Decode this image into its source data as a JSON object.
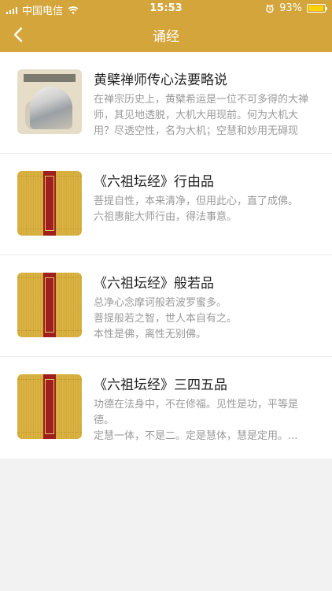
{
  "status": {
    "carrier": "中国电信",
    "time": "15:53",
    "battery_percent_text": "93%",
    "battery_level": 0.93,
    "signal_icon": "signal-icon",
    "wifi_icon": "wifi-icon",
    "alarm_icon": "alarm-icon"
  },
  "nav": {
    "title": "诵经",
    "back_icon": "back-chevron-icon"
  },
  "items": [
    {
      "title": "黄檗禅师传心法要略说",
      "desc": "在禅宗历史上，黄檗希运是一位不可多得的大禅师，其见地透脱，大机大用现前。何为大机大用？尽透空性，名为大机；空慧和妙用无碍现前..."
    },
    {
      "title": "《六祖坛经》行由品",
      "desc": "菩提自性，本来清净，但用此心，直了成佛。\n六祖惠能大师行由，得法事意。"
    },
    {
      "title": "《六祖坛经》般若品",
      "desc": "总净心念摩诃般若波罗蜜多。\n菩提般若之智，世人本自有之。\n本性是佛，离性无别佛。"
    },
    {
      "title": "《六祖坛经》三四五品",
      "desc": "功德在法身中，不在修福。见性是功，平等是德。\n定慧一体，不是二。定是慧体，慧是定用。..."
    }
  ],
  "colors": {
    "accent": "#d4a53a",
    "title_text": "#222222",
    "desc_text": "#9a9a9a"
  }
}
